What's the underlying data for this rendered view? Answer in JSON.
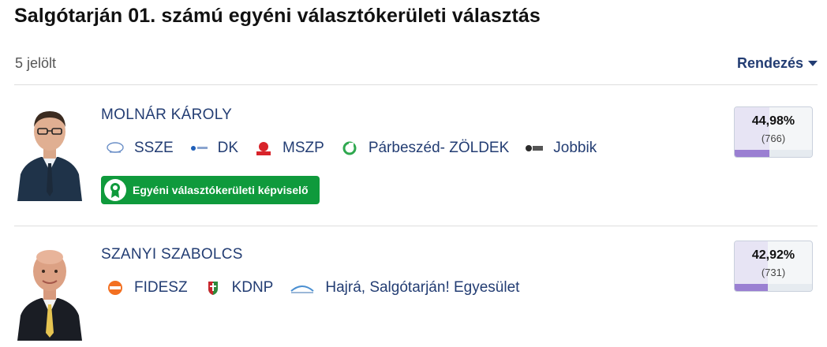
{
  "title": "Salgótarján 01. számú egyéni választókerületi választás",
  "candidate_count": "5 jelölt",
  "sort_label": "Rendezés",
  "candidates": [
    {
      "name": "MOLNÁR KÁROLY",
      "parties": [
        {
          "label": "SSZE",
          "icon": "ssze-logo-icon"
        },
        {
          "label": "DK",
          "icon": "dk-logo-icon"
        },
        {
          "label": "MSZP",
          "icon": "mszp-logo-icon"
        },
        {
          "label": "Párbeszéd- ZÖLDEK",
          "icon": "parbeszed-logo-icon"
        },
        {
          "label": "Jobbik",
          "icon": "jobbik-logo-icon"
        }
      ],
      "badge": "Egyéni választókerületi képviselő",
      "percent": "44,98%",
      "votes": "(766)",
      "share": 0.4498,
      "bar_fraction": 0.45
    },
    {
      "name": "SZANYI SZABOLCS",
      "parties": [
        {
          "label": "FIDESZ",
          "icon": "fidesz-logo-icon"
        },
        {
          "label": "KDNP",
          "icon": "kdnp-logo-icon"
        },
        {
          "label": "Hajrá, Salgótarján! Egyesület",
          "icon": "hajra-logo-icon"
        }
      ],
      "percent": "42,92%",
      "votes": "(731)",
      "share": 0.4292,
      "bar_fraction": 0.43
    }
  ],
  "colors": {
    "accent": "#233d73",
    "winner_badge": "#0f9a3c",
    "result_bar": "#9a7fd2",
    "result_fill": "#e7e4f4"
  }
}
